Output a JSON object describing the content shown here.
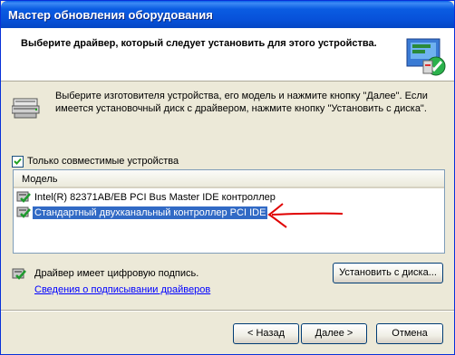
{
  "window": {
    "title": "Мастер обновления оборудования"
  },
  "header": {
    "text": "Выберите драйвер, который следует установить для этого устройства.",
    "icon": "hardware-wizard-icon"
  },
  "intro": {
    "icon": "printer-icon",
    "text": "Выберите изготовителя устройства, его модель и нажмите кнопку \"Далее\". Если имеется установочный диск с  драйвером, нажмите кнопку \"Установить с диска\"."
  },
  "compatible": {
    "label": "Только совместимые устройства",
    "checked": true
  },
  "list": {
    "column_header": "Модель",
    "items": [
      {
        "label": "Intel(R) 82371AB/EB PCI Bus Master IDE контроллер",
        "selected": false,
        "icon": "signed-driver-icon"
      },
      {
        "label": "Стандартный двухканальный контроллер PCI IDE",
        "selected": true,
        "icon": "signed-driver-icon"
      }
    ]
  },
  "signature": {
    "text": "Драйвер имеет цифровую подпись.",
    "link": "Сведения о подписывании драйверов",
    "icon": "signed-driver-icon"
  },
  "buttons": {
    "have_disk": "Установить с диска...",
    "back": "< Назад",
    "next": "Далее >",
    "cancel": "Отмена"
  },
  "colors": {
    "titlebar": "#0a5ce2",
    "selection": "#316ac5",
    "annotation_arrow": "#e00000",
    "link": "#0000ff"
  }
}
